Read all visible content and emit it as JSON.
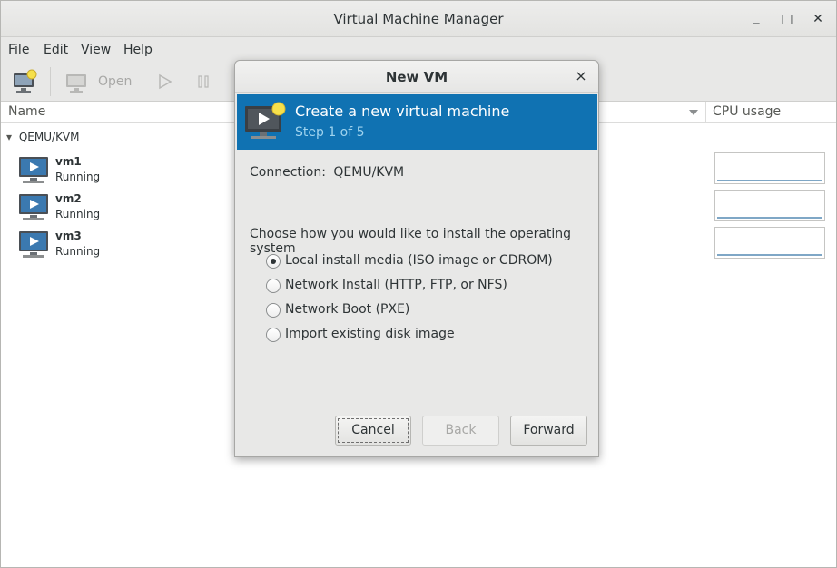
{
  "window": {
    "title": "Virtual Machine Manager",
    "minimize_glyph": "_",
    "maximize_glyph": "□",
    "close_glyph": "✕"
  },
  "menu": [
    "File",
    "Edit",
    "View",
    "Help"
  ],
  "toolbar": {
    "open_label": "Open",
    "new_vm_icon": "new-vm-icon",
    "console_icon": "monitor-icon",
    "run_icon": "play-icon",
    "pause_icon": "pause-icon"
  },
  "columns": {
    "name": "Name",
    "cpu": "CPU usage"
  },
  "group": {
    "arrow": "▾",
    "label": "QEMU/KVM"
  },
  "vms": [
    {
      "name": "vm1",
      "status": "Running"
    },
    {
      "name": "vm2",
      "status": "Running"
    },
    {
      "name": "vm3",
      "status": "Running"
    }
  ],
  "dialog": {
    "title": "New VM",
    "close_glyph": "×",
    "banner_title": "Create a new virtual machine",
    "banner_step": "Step 1 of 5",
    "connection_label": "Connection:",
    "connection_value": "QEMU/KVM",
    "prompt": "Choose how you would like to install the operating system",
    "options": [
      {
        "label": "Local install media (ISO image or CDROM)",
        "checked": true
      },
      {
        "label": "Network Install (HTTP, FTP, or NFS)",
        "checked": false
      },
      {
        "label": "Network Boot (PXE)",
        "checked": false
      },
      {
        "label": "Import existing disk image",
        "checked": false
      }
    ],
    "buttons": {
      "cancel": "Cancel",
      "back": "Back",
      "forward": "Forward"
    }
  },
  "colors": {
    "banner": "#1072b2",
    "banner_step": "#9fd3ee",
    "chrome": "#e8e8e7"
  }
}
